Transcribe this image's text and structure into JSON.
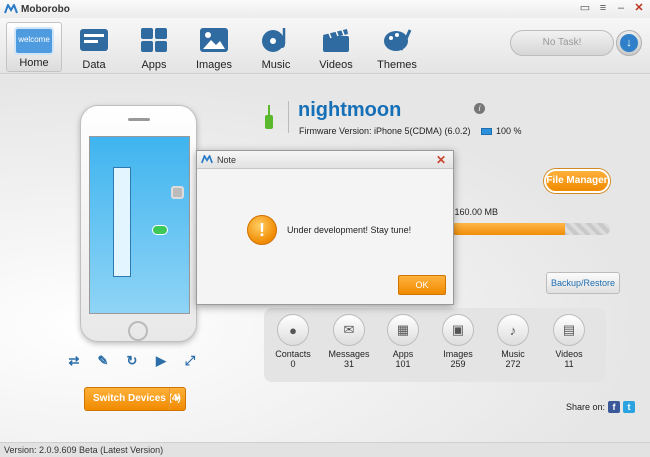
{
  "app": {
    "name": "Moborobo"
  },
  "window_controls": [
    "minimize-to-tray",
    "menu",
    "minimize",
    "close"
  ],
  "nav": [
    {
      "label": "Home",
      "icon": "welcome-icon",
      "active": true
    },
    {
      "label": "Data",
      "icon": "data-icon"
    },
    {
      "label": "Apps",
      "icon": "apps-icon"
    },
    {
      "label": "Images",
      "icon": "images-icon"
    },
    {
      "label": "Music",
      "icon": "music-icon"
    },
    {
      "label": "Videos",
      "icon": "videos-icon"
    },
    {
      "label": "Themes",
      "icon": "themes-icon"
    }
  ],
  "welcome_badge": "welcome",
  "task": {
    "label": "No Task!"
  },
  "device": {
    "name": "nightmoon",
    "firmware": "Firmware Version: iPhone 5(CDMA) (6.0.2)",
    "battery": "100 %"
  },
  "storage": {
    "text": ":160.00 MB",
    "fill_fraction": 0.72
  },
  "buttons": {
    "file_manager": "File Manager",
    "backup_restore": "Backup/Restore",
    "switch_devices": "Switch Devices (4)"
  },
  "categories": [
    {
      "name": "Contacts",
      "count": "0",
      "icon": "person-icon",
      "glyph": "●"
    },
    {
      "name": "Messages",
      "count": "31",
      "icon": "envelope-icon",
      "glyph": "✉"
    },
    {
      "name": "Apps",
      "count": "101",
      "icon": "apps-grid-icon",
      "glyph": "▦"
    },
    {
      "name": "Images",
      "count": "259",
      "icon": "picture-icon",
      "glyph": "▣"
    },
    {
      "name": "Music",
      "count": "272",
      "icon": "music-note-icon",
      "glyph": "♪"
    },
    {
      "name": "Videos",
      "count": "11",
      "icon": "clapper-icon",
      "glyph": "▤"
    }
  ],
  "share": {
    "label": "Share on:"
  },
  "status": {
    "version": "Version: 2.0.9.609 Beta  (Latest Version)"
  },
  "dialog": {
    "title": "Note",
    "message": "Under development! Stay tune!",
    "ok": "OK"
  },
  "colors": {
    "accent": "#f08a00",
    "brand_blue": "#1670b8"
  }
}
